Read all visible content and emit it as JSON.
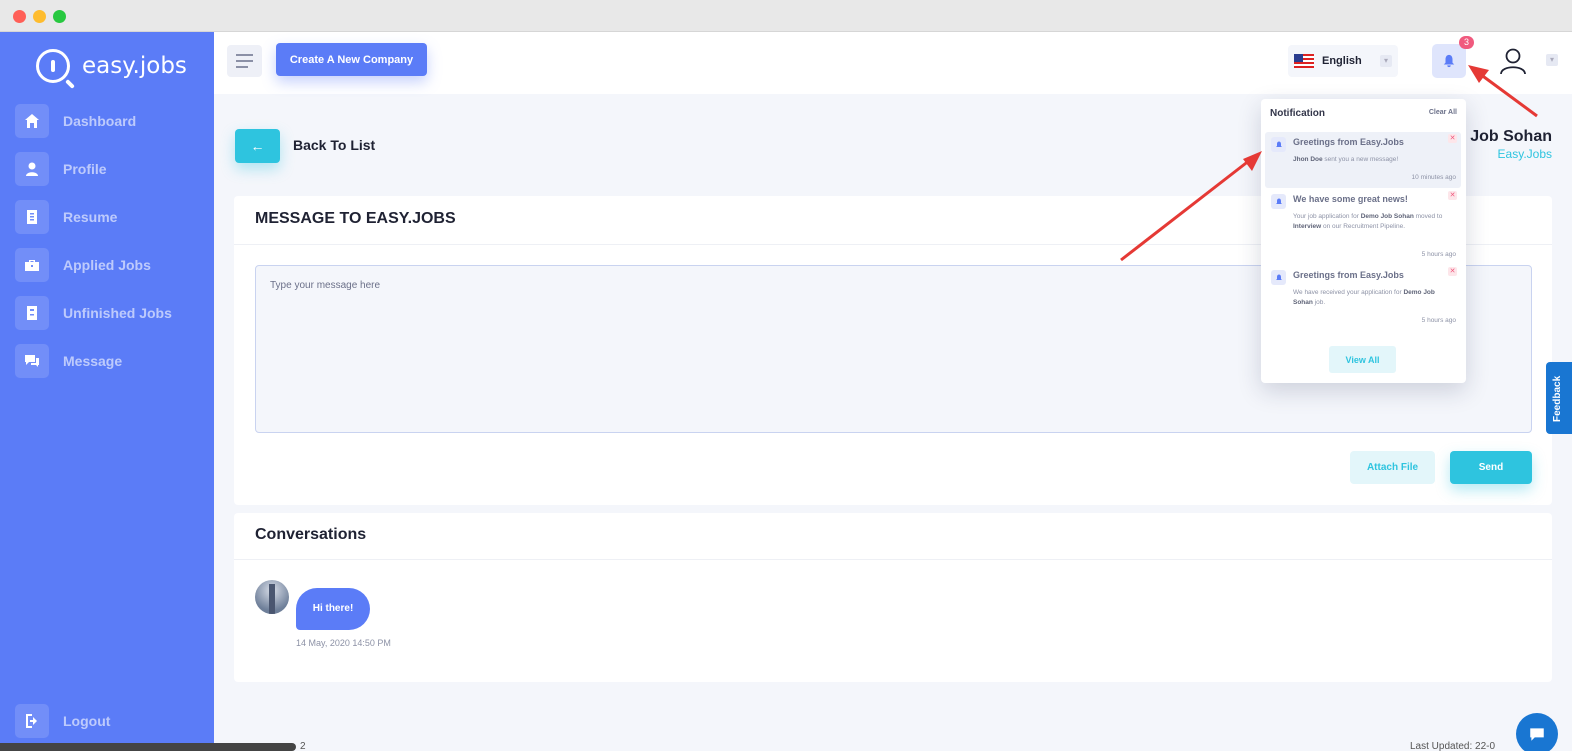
{
  "app": {
    "brand": "easy.jobs"
  },
  "sidebar": {
    "items": [
      {
        "label": "Dashboard",
        "icon": "home-icon"
      },
      {
        "label": "Profile",
        "icon": "user-icon"
      },
      {
        "label": "Resume",
        "icon": "resume-icon"
      },
      {
        "label": "Applied Jobs",
        "icon": "briefcase-icon"
      },
      {
        "label": "Unfinished Jobs",
        "icon": "document-icon"
      },
      {
        "label": "Message",
        "icon": "chat-icon"
      }
    ],
    "logout_label": "Logout"
  },
  "header": {
    "create_company_label": "Create A New Company",
    "language": "English",
    "notification_count": "3"
  },
  "page": {
    "back_label": "Back To List",
    "job_title": "o Job Sohan",
    "company": "Easy.Jobs"
  },
  "message": {
    "title_prefix": "MESSAGE TO ",
    "title_company": "EASY.JOBS",
    "placeholder": "Type your message here",
    "attach_label": "Attach File",
    "send_label": "Send"
  },
  "conversations": {
    "title": "Conversations",
    "messages": [
      {
        "text": "Hi there!",
        "time": "14 May, 2020 14:50 PM"
      }
    ]
  },
  "notifications": {
    "title": "Notification",
    "clear_label": "Clear All",
    "view_all_label": "View All",
    "items": [
      {
        "title": "Greetings from Easy.Jobs",
        "body_strong_1": "Jhon Doe",
        "body_text_1": " sent you a new message!",
        "time": "10 minutes ago"
      },
      {
        "title": "We have some great news!",
        "body_text_1": "Your job application for ",
        "body_strong_1": "Demo Job Sohan",
        "body_text_2": " moved to ",
        "body_strong_2": "Interview",
        "body_text_3": " on our Recruitment Pipeline.",
        "time": "5 hours ago"
      },
      {
        "title": "Greetings from Easy.Jobs",
        "body_text_1": "We have received your application for ",
        "body_strong_1": "Demo Job Sohan",
        "body_text_2": " job.",
        "time": "5 hours ago"
      }
    ]
  },
  "feedback_label": "Feedback",
  "footer": {
    "left_fragment": "2",
    "right_fragment": "Last Updated: 22-0"
  },
  "colors": {
    "primary": "#5b7cf7",
    "accent": "#2ec4df",
    "danger": "#f05a7e",
    "arrow": "#e53935"
  }
}
